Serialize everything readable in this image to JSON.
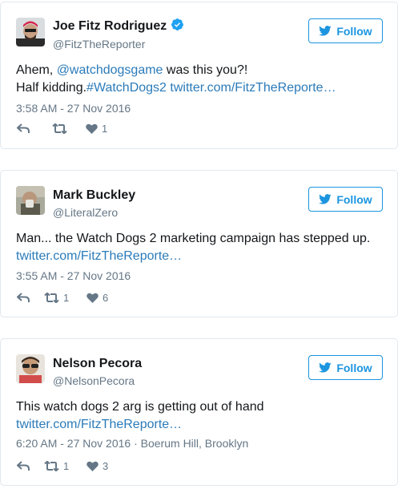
{
  "tweets": [
    {
      "name": "Joe Fitz Rodriguez",
      "verified": true,
      "handle": "@FitzTheReporter",
      "follow_label": "Follow",
      "line1_pre": "Ahem, ",
      "line1_link": "@watchdogsgame",
      "line1_post": " was this you?!",
      "line2_pre": "Half kidding.",
      "line2_hashtag": "#WatchDogs2",
      "line2_link": " twitter.com/FitzTheReporte…",
      "timestamp": "3:58 AM - 27 Nov 2016",
      "retweets": "",
      "likes": "1"
    },
    {
      "name": "Mark Buckley",
      "verified": false,
      "handle": "@LiteralZero",
      "follow_label": "Follow",
      "line1": "Man... the Watch Dogs 2 marketing campaign has stepped up.",
      "line2_link": "twitter.com/FitzTheReporte…",
      "timestamp": "3:55 AM - 27 Nov 2016",
      "retweets": "1",
      "likes": "6"
    },
    {
      "name": "Nelson Pecora",
      "verified": false,
      "handle": "@NelsonPecora",
      "follow_label": "Follow",
      "line1": "This watch dogs 2 arg is getting out of hand",
      "line2_link": "twitter.com/FitzTheReporte…",
      "timestamp": "6:20 AM - 27 Nov 2016",
      "location": "Boerum Hill, Brooklyn",
      "retweets": "1",
      "likes": "3"
    }
  ],
  "colors": {
    "link": "#2b7bb9",
    "follow": "#1b95e0",
    "muted": "#657786",
    "verified": "#1da1f2"
  },
  "icons": [
    "reply-icon",
    "retweet-icon",
    "like-icon",
    "twitter-bird-icon",
    "verified-badge-icon"
  ]
}
